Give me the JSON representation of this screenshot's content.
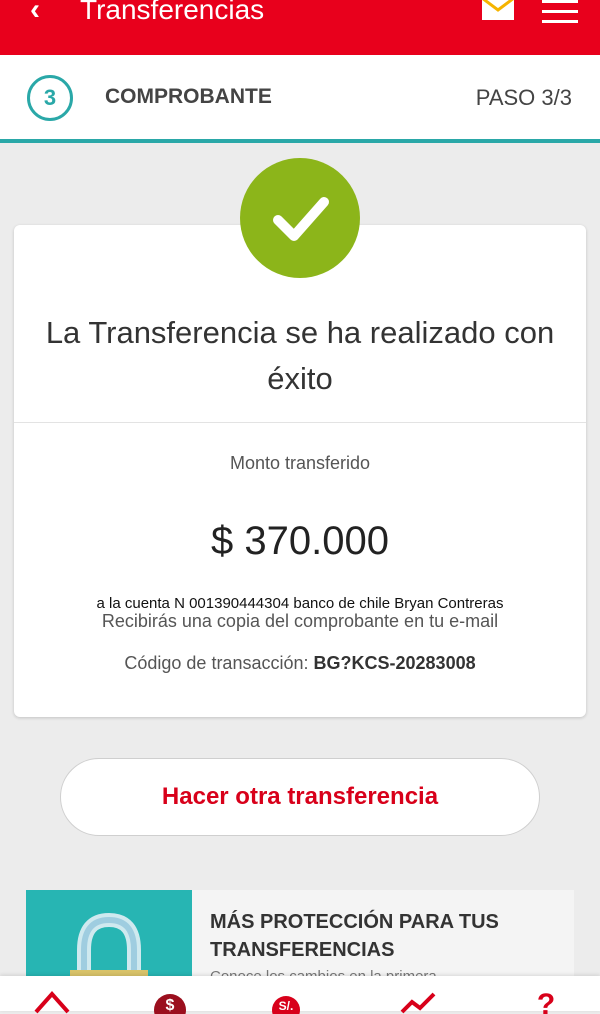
{
  "header": {
    "back_icon": "chevron-left-icon",
    "title": "Transferencias",
    "mail_icon": "mail-icon",
    "menu_icon": "hamburger-menu-icon"
  },
  "stepper": {
    "step_number": "3",
    "step_label": "COMPROBANTE",
    "step_count": "PASO 3/3"
  },
  "receipt": {
    "status_icon": "check-circle-icon",
    "success_message": "La Transferencia se ha realizado con éxito",
    "amount_label": "Monto transferido",
    "amount": "$ 370.000",
    "account_info": "a la cuenta N 001390444304 banco de chile Bryan Contreras",
    "copy_notice": "Recibirás una copia del comprobante en tu e-mail",
    "code_label": "Código de transacción:",
    "code_value": "BG?KCS-20283008"
  },
  "actions": {
    "another_transfer": "Hacer otra transferencia"
  },
  "promo": {
    "title_line1": "MÁS PROTECCIÓN PARA TUS",
    "title_line2": "TRANSFERENCIAS",
    "subtitle": "Conoce los cambios en la primera"
  },
  "bottom_nav": {
    "items": [
      "home-icon",
      "dollar-icon",
      "exchange-icon",
      "chart-icon",
      "help-icon"
    ]
  },
  "colors": {
    "brand_red": "#e8001c",
    "teal": "#2aa8a8",
    "success_green": "#8cb51a"
  }
}
